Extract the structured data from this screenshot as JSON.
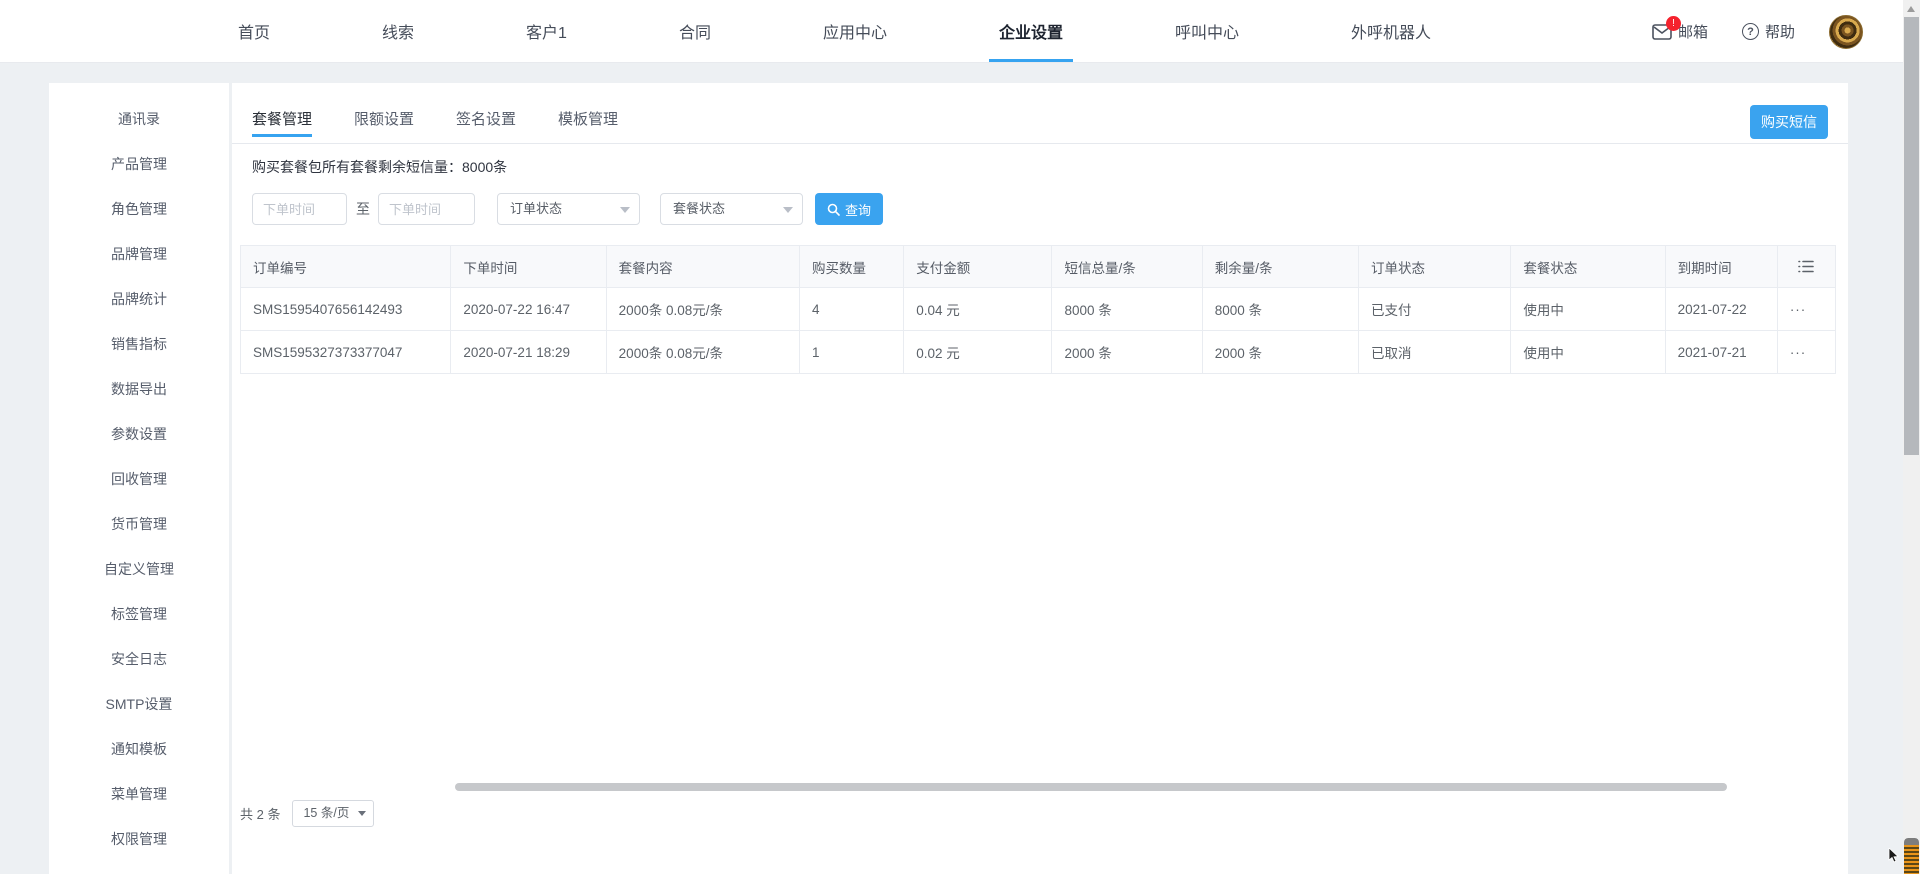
{
  "colors": {
    "accent": "#3aa3ef",
    "badge": "#f5222d"
  },
  "header": {
    "nav": [
      "首页",
      "线索",
      "客户1",
      "合同",
      "应用中心",
      "企业设置",
      "呼叫中心",
      "外呼机器人"
    ],
    "mail": {
      "label": "邮箱",
      "badge": "!"
    },
    "help": {
      "label": "帮助"
    }
  },
  "sidebar": {
    "items": [
      "通讯录",
      "产品管理",
      "角色管理",
      "品牌管理",
      "品牌统计",
      "销售指标",
      "数据导出",
      "参数设置",
      "回收管理",
      "货币管理",
      "自定义管理",
      "标签管理",
      "安全日志",
      "SMTP设置",
      "通知模板",
      "菜单管理",
      "权限管理"
    ]
  },
  "main": {
    "tabs": [
      "套餐管理",
      "限额设置",
      "签名设置",
      "模板管理"
    ],
    "buy_button": "购买短信",
    "summary": "购买套餐包所有套餐剩余短信量：8000条",
    "filters": {
      "start_placeholder": "下单时间",
      "to_label": "至",
      "end_placeholder": "下单时间",
      "order_status": "订单状态",
      "package_status": "套餐状态",
      "search_label": "查询"
    },
    "table": {
      "columns": [
        "订单编号",
        "下单时间",
        "套餐内容",
        "购买数量",
        "支付金额",
        "短信总量/条",
        "剩余量/条",
        "订单状态",
        "套餐状态",
        "到期时间"
      ],
      "rows": [
        [
          "SMS1595407656142493",
          "2020-07-22 16:47",
          "2000条 0.08元/条",
          "4",
          "0.04 元",
          "8000 条",
          "8000 条",
          "已支付",
          "使用中",
          "2021-07-22"
        ],
        [
          "SMS1595327373377047",
          "2020-07-21 18:29",
          "2000条 0.08元/条",
          "1",
          "0.02 元",
          "2000 条",
          "2000 条",
          "已取消",
          "使用中",
          "2021-07-21"
        ]
      ],
      "row_action": "···"
    },
    "pagination": {
      "total": "共 2 条",
      "page_size": "15 条/页"
    }
  }
}
